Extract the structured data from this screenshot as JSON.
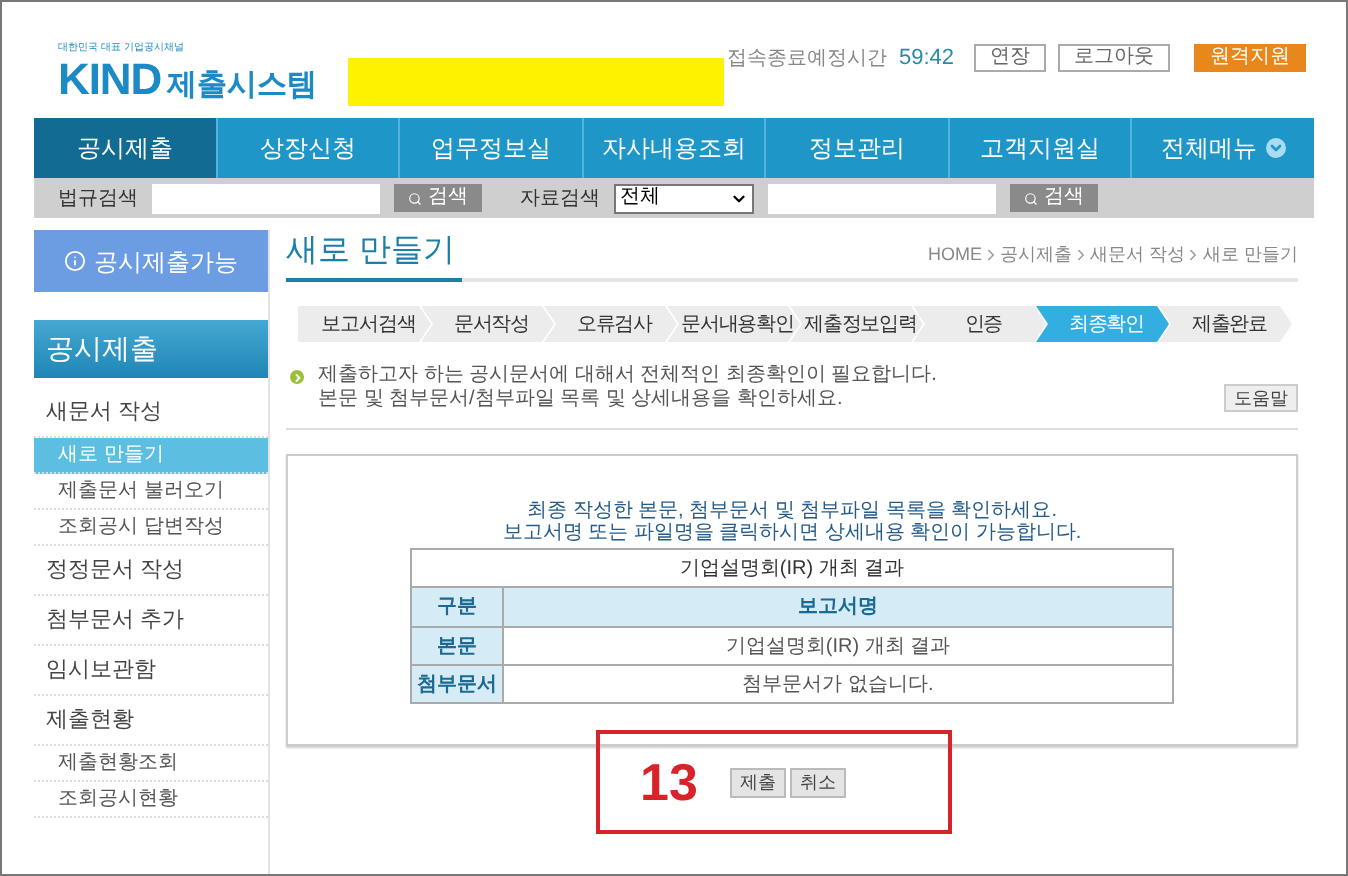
{
  "header": {
    "logo_tagline": "대한민국 대표 기업공시채널",
    "logo_mark": "KIND",
    "logo_name": "제출시스템",
    "session_label": "접속종료예정시간",
    "session_time": "59:42",
    "buttons": [
      {
        "label": "연장",
        "kind": "outline"
      },
      {
        "label": "로그아웃",
        "kind": "outline"
      },
      {
        "label": "원격지원",
        "kind": "accent"
      }
    ]
  },
  "nav": [
    {
      "label": "공시제출",
      "selected": true,
      "kind": "link"
    },
    {
      "label": "상장신청",
      "selected": false,
      "kind": "link"
    },
    {
      "label": "업무정보실",
      "selected": false,
      "kind": "link"
    },
    {
      "label": "자사내용조회",
      "selected": false,
      "kind": "link"
    },
    {
      "label": "정보관리",
      "selected": false,
      "kind": "link"
    },
    {
      "label": "고객지원실",
      "selected": false,
      "kind": "link"
    },
    {
      "label": "전체메뉴",
      "selected": false,
      "kind": "menu"
    }
  ],
  "search_bar": {
    "law_label": "법규검색",
    "law_button": "검색",
    "data_label": "자료검색",
    "data_select": "전체",
    "data_button": "검색"
  },
  "sidebar": {
    "status_button": "공시제출가능",
    "section_title": "공시제출",
    "items": [
      {
        "label": "새문서 작성",
        "kind": "group",
        "selected": false
      },
      {
        "label": "새로 만들기",
        "kind": "sub",
        "selected": true
      },
      {
        "label": "제출문서 불러오기",
        "kind": "sub",
        "selected": false
      },
      {
        "label": "조회공시 답변작성",
        "kind": "sub",
        "selected": false
      },
      {
        "label": "정정문서 작성",
        "kind": "group",
        "selected": false
      },
      {
        "label": "첨부문서 추가",
        "kind": "group",
        "selected": false
      },
      {
        "label": "임시보관함",
        "kind": "group",
        "selected": false
      },
      {
        "label": "제출현황",
        "kind": "group",
        "selected": false
      },
      {
        "label": "제출현황조회",
        "kind": "sub",
        "selected": false
      },
      {
        "label": "조회공시현황",
        "kind": "sub",
        "selected": false
      }
    ]
  },
  "page": {
    "title": "새로 만들기",
    "breadcrumb": [
      "HOME",
      "공시제출",
      "새문서 작성",
      "새로 만들기"
    ],
    "steps": [
      {
        "label": "보고서검색",
        "selected": false
      },
      {
        "label": "문서작성",
        "selected": false
      },
      {
        "label": "오류검사",
        "selected": false
      },
      {
        "label": "문서내용확인",
        "selected": false
      },
      {
        "label": "제출정보입력",
        "selected": false
      },
      {
        "label": "인증",
        "selected": false
      },
      {
        "label": "최종확인",
        "selected": true
      },
      {
        "label": "제출완료",
        "selected": false
      }
    ],
    "notice": [
      "제출하고자 하는 공시문서에 대해서 전체적인 최종확인이 필요합니다.",
      "본문 및 첨부문서/첨부파일 목록 및 상세내용을 확인하세요."
    ],
    "help_button": "도움말",
    "summary": [
      "최종 작성한 본문, 첨부문서 및 첨부파일 목록을 확인하세요.",
      "보고서명 또는 파일명을 클릭하시면 상세내용 확인이 가능합니다."
    ],
    "table": {
      "caption": "기업설명회(IR) 개최 결과",
      "columns": [
        "구분",
        "보고서명"
      ],
      "rows": [
        [
          "본문",
          "기업설명회(IR) 개최 결과"
        ],
        [
          "첨부문서",
          "첨부문서가 없습니다."
        ]
      ]
    },
    "annotation": "13",
    "buttons": [
      "제출",
      "취소"
    ]
  }
}
